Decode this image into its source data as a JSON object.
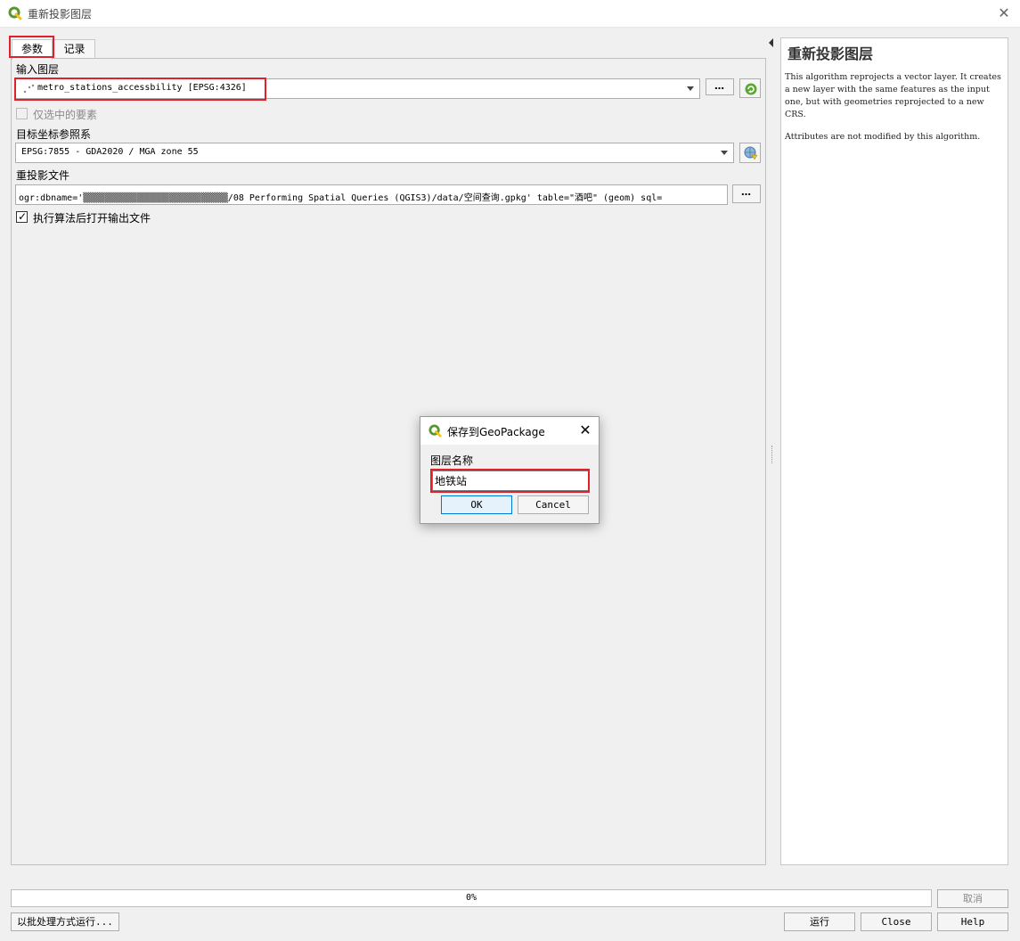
{
  "window": {
    "title": "重新投影图层",
    "close_glyph": "✕"
  },
  "tabs": {
    "params": "参数",
    "log": "记录"
  },
  "input_layer": {
    "label": "输入图层",
    "value": "metro_stations_accessbility [EPSG:4326]",
    "browse_label": "…"
  },
  "selected_only": {
    "label": "仅选中的要素",
    "checked": false
  },
  "target_crs": {
    "label": "目标坐标参照系",
    "value": "EPSG:7855 - GDA2020 / MGA zone 55"
  },
  "output_file": {
    "label": "重投影文件",
    "value": "ogr:dbname='▒▒▒▒▒▒▒▒▒▒▒▒▒▒▒▒▒▒▒▒▒▒▒▒▒▒▒/08 Performing Spatial Queries (QGIS3)/data/空间查询.gpkg' table=\"酒吧\" (geom) sql=",
    "browse_label": "…"
  },
  "open_after": {
    "label": "执行算法后打开输出文件",
    "checked": true
  },
  "help": {
    "title": "重新投影图层",
    "paragraph1": "This algorithm reprojects a vector layer. It creates a new layer with the same features as the input one, but with geometries reprojected to a new CRS.",
    "paragraph2": "Attributes are not modified by this algorithm."
  },
  "progress": {
    "value": 0,
    "text": "0%"
  },
  "buttons": {
    "cancel": "取消",
    "batch": "以批处理方式运行...",
    "run": "运行",
    "close": "Close",
    "help": "Help"
  },
  "dialog": {
    "title": "保存到GeoPackage",
    "label": "图层名称",
    "input_value": "地铁站",
    "ok": "OK",
    "cancel": "Cancel",
    "close_glyph": "✕"
  },
  "colors": {
    "highlight": "#e0202a",
    "qgis_green": "#589632",
    "qgis_yellow": "#f0c419"
  },
  "icons": {
    "app": "qgis-logo-icon",
    "iterate": "iterate-green-icon",
    "crs": "globe-crs-icon"
  }
}
